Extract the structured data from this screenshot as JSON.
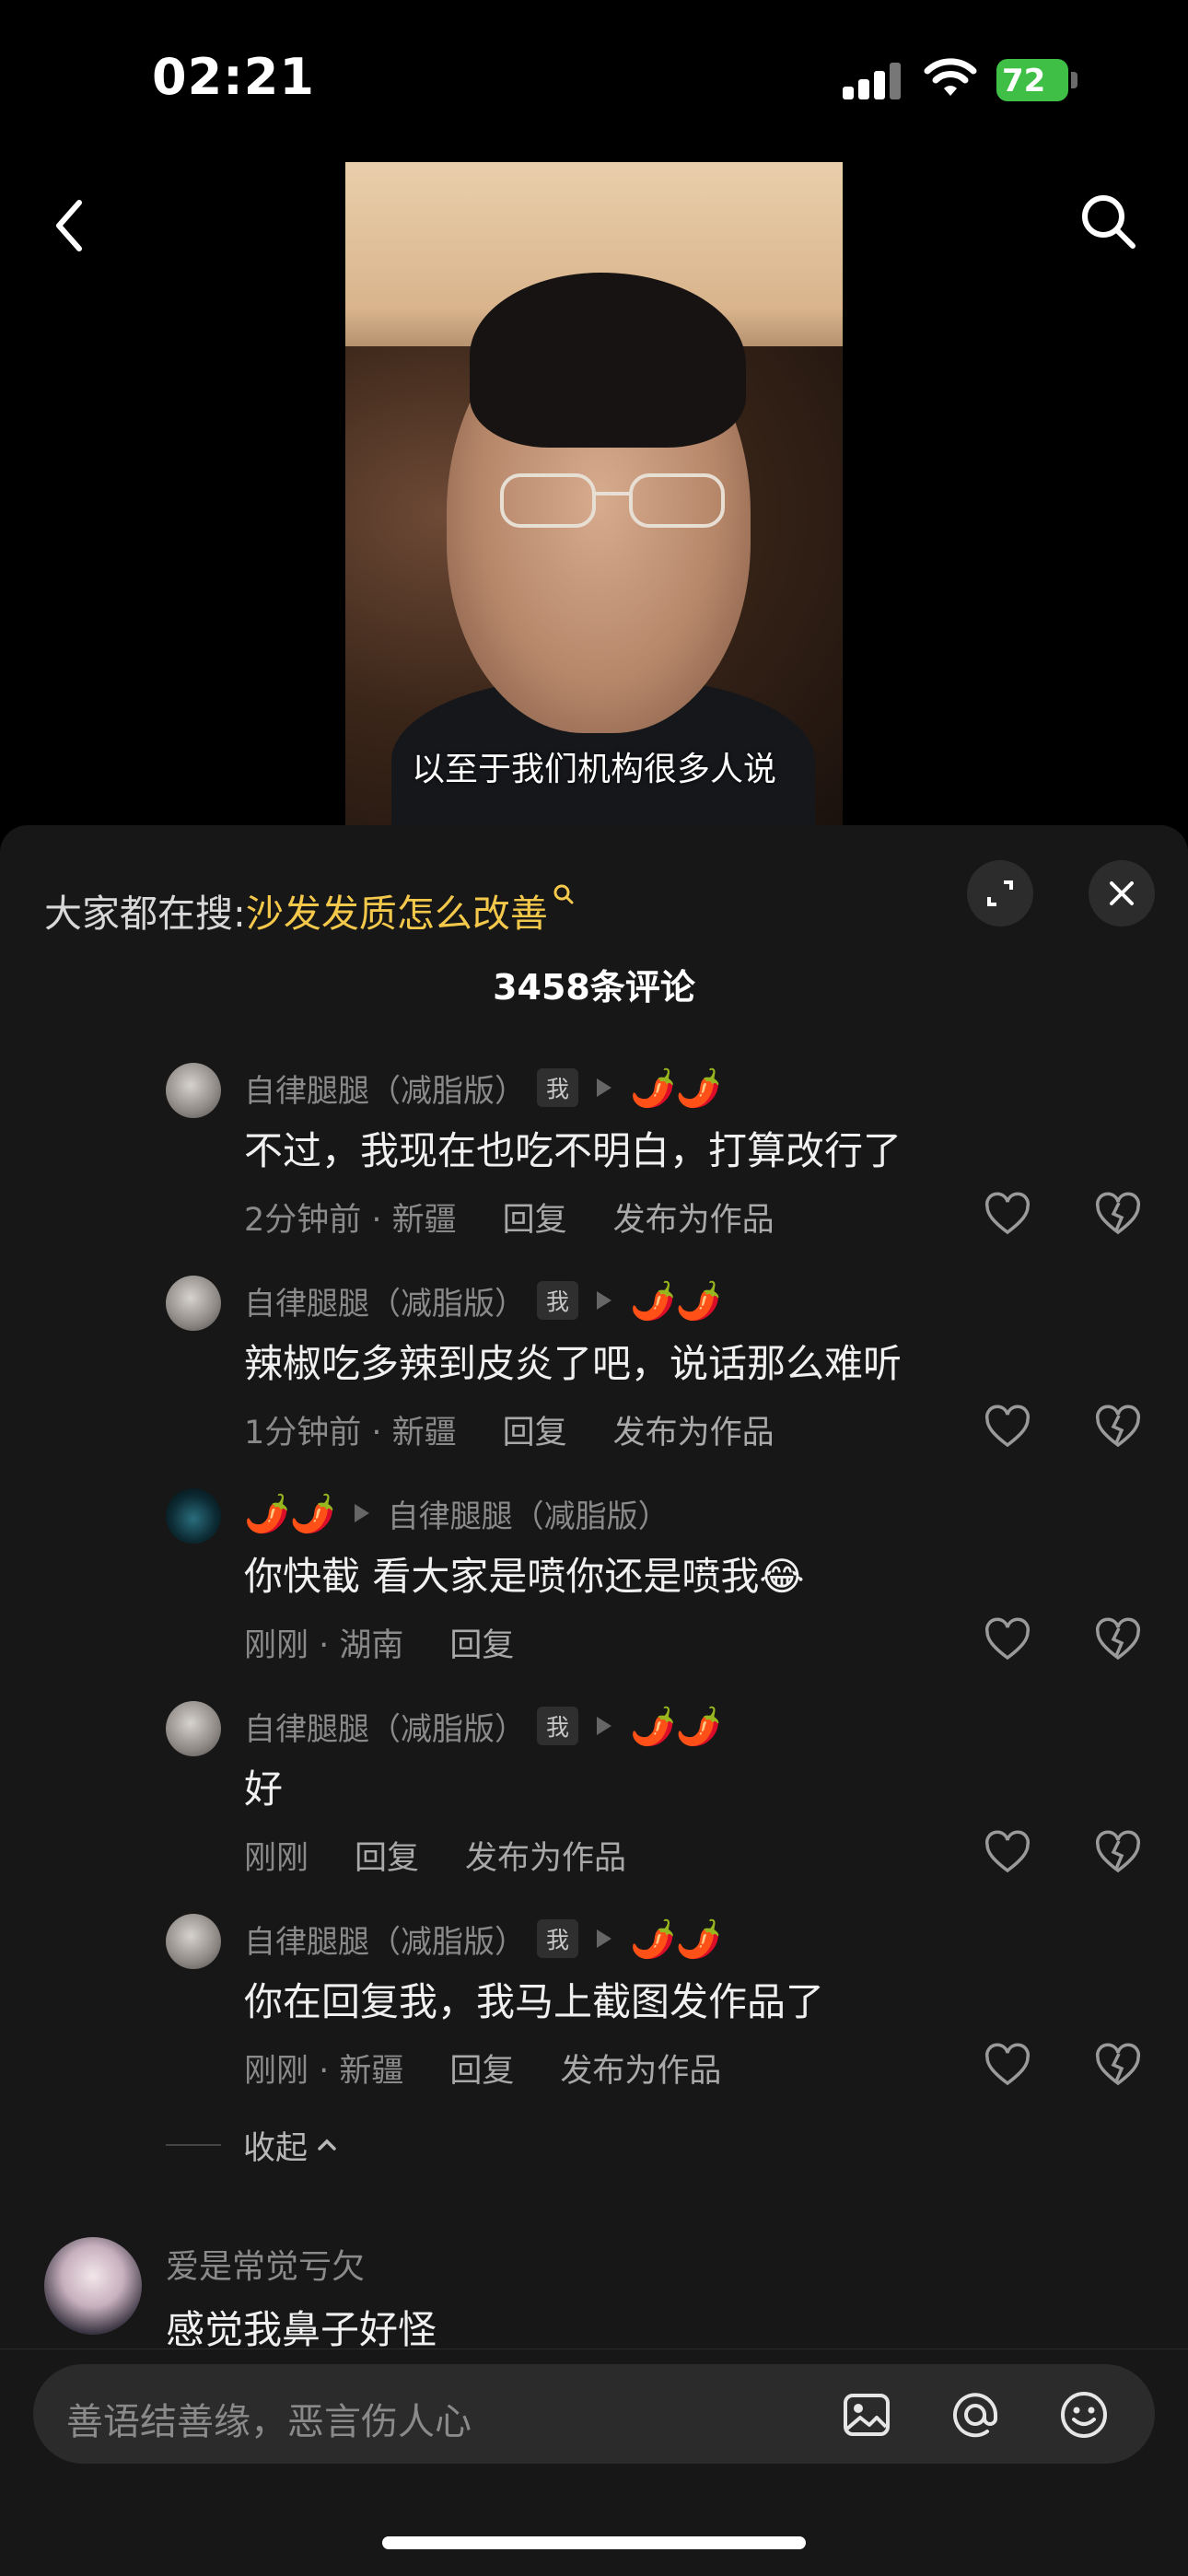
{
  "status": {
    "time": "02:21",
    "battery": "72"
  },
  "video": {
    "subtitle": "以至于我们机构很多人说"
  },
  "sheet": {
    "hot_search_label": "大家都在搜:",
    "hot_search_keyword": "沙发发质怎么改善",
    "comment_count": "3458条评论"
  },
  "replies": [
    {
      "user": "自律腿腿（减脂版）",
      "me_badge": "我",
      "target": "🌶️🌶️",
      "text": "不过，我现在也吃不明白，打算改行了",
      "meta": "2分钟前 · 新疆",
      "reply_label": "回复",
      "post_label": "发布为作品"
    },
    {
      "user": "自律腿腿（减脂版）",
      "me_badge": "我",
      "target": "🌶️🌶️",
      "text": "辣椒吃多辣到皮炎了吧，说话那么难听",
      "meta": "1分钟前 · 新疆",
      "reply_label": "回复",
      "post_label": "发布为作品"
    },
    {
      "user": "🌶️🌶️",
      "target": "自律腿腿（减脂版）",
      "text": "你快截 看大家是喷你还是喷我😂",
      "meta": "刚刚 · 湖南",
      "reply_label": "回复"
    },
    {
      "user": "自律腿腿（减脂版）",
      "me_badge": "我",
      "target": "🌶️🌶️",
      "text": "好",
      "meta": "刚刚",
      "reply_label": "回复",
      "post_label": "发布为作品"
    },
    {
      "user": "自律腿腿（减脂版）",
      "me_badge": "我",
      "target": "🌶️🌶️",
      "text": "你在回复我，我马上截图发作品了",
      "meta": "刚刚 · 新疆",
      "reply_label": "回复",
      "post_label": "发布为作品"
    }
  ],
  "collapse_label": "收起",
  "top_comment": {
    "user": "爱是常觉亏欠",
    "text": "感觉我鼻子好怪"
  },
  "input": {
    "placeholder": "善语结善缘，恶言伤人心"
  }
}
